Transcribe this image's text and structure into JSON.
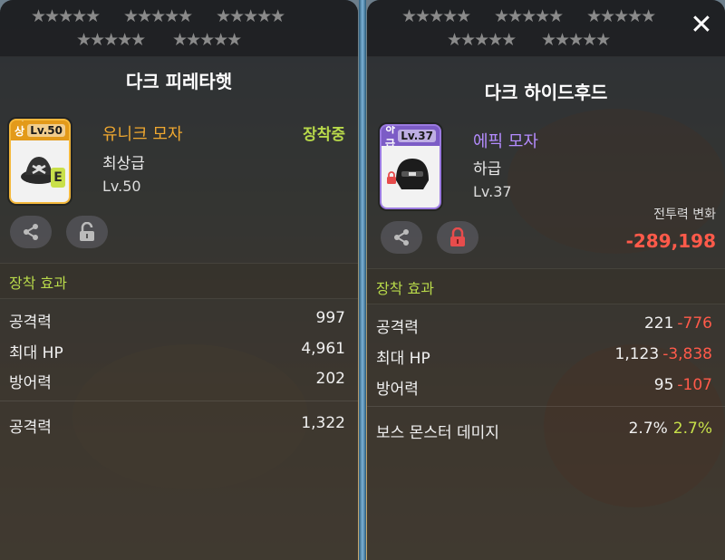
{
  "colors": {
    "uncommon_green": "#b8d94a",
    "negative_red": "#ff5a4a",
    "legendary_gold": "#f0a830",
    "epic_purple": "#b48cff"
  },
  "left": {
    "title": "다크 피레타햇",
    "card": {
      "grade_label": "최상급",
      "level_label": "Lv.50",
      "badge": "E"
    },
    "grade_name": "유니크 모자",
    "grade_sub": "최상급",
    "level": "Lv.50",
    "equipped": "장착중",
    "section_title": "장착 효과",
    "stats": [
      {
        "label": "공격력",
        "value": "997"
      },
      {
        "label": "최대 HP",
        "value": "4,961"
      },
      {
        "label": "방어력",
        "value": "202"
      }
    ],
    "extra_stats": [
      {
        "label": "공격력",
        "value": "1,322"
      }
    ]
  },
  "right": {
    "title": "다크 하이드후드",
    "card": {
      "grade_label": "하급",
      "level_label": "Lv.37"
    },
    "grade_name": "에픽 모자",
    "grade_sub": "하급",
    "level": "Lv.37",
    "power_change_label": "전투력 변화",
    "power_change_value": "-289,198",
    "section_title": "장착 효과",
    "stats": [
      {
        "label": "공격력",
        "value": "221",
        "diff": "-776"
      },
      {
        "label": "최대 HP",
        "value": "1,123",
        "diff": "-3,838"
      },
      {
        "label": "방어력",
        "value": "95",
        "diff": "-107"
      }
    ],
    "extra_stats": [
      {
        "label": "보스 몬스터 데미지",
        "value": "2.7%",
        "diff": "2.7%"
      }
    ]
  },
  "close_icon": "close-icon"
}
